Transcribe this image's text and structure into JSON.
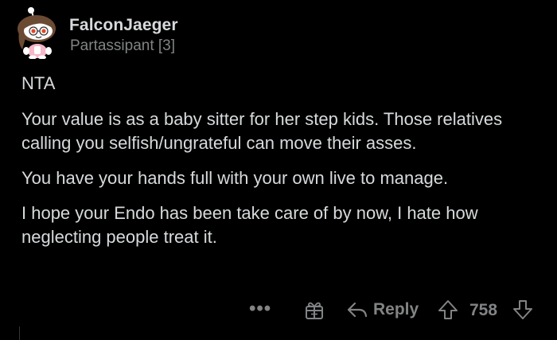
{
  "comment": {
    "author": "FalconJaeger",
    "flair": "Partassipant [3]",
    "paragraphs": [
      "NTA",
      "Your value is as a baby sitter for her step kids. Those relatives calling you selfish/ungrateful can move their asses.",
      "You have your hands full with your own live to manage.",
      "I hope your Endo has been take care of by now, I hate how neglecting people treat it."
    ]
  },
  "actions": {
    "more": "•••",
    "reply_label": "Reply",
    "score": "758"
  },
  "icons": {
    "avatar": "snoo-avatar-icon",
    "more": "more-options-icon",
    "award": "award-gift-icon",
    "reply": "reply-arrow-icon",
    "upvote": "upvote-arrow-icon",
    "downvote": "downvote-arrow-icon"
  },
  "colors": {
    "background": "#000000",
    "text": "#d7dadc",
    "muted": "#818384"
  }
}
